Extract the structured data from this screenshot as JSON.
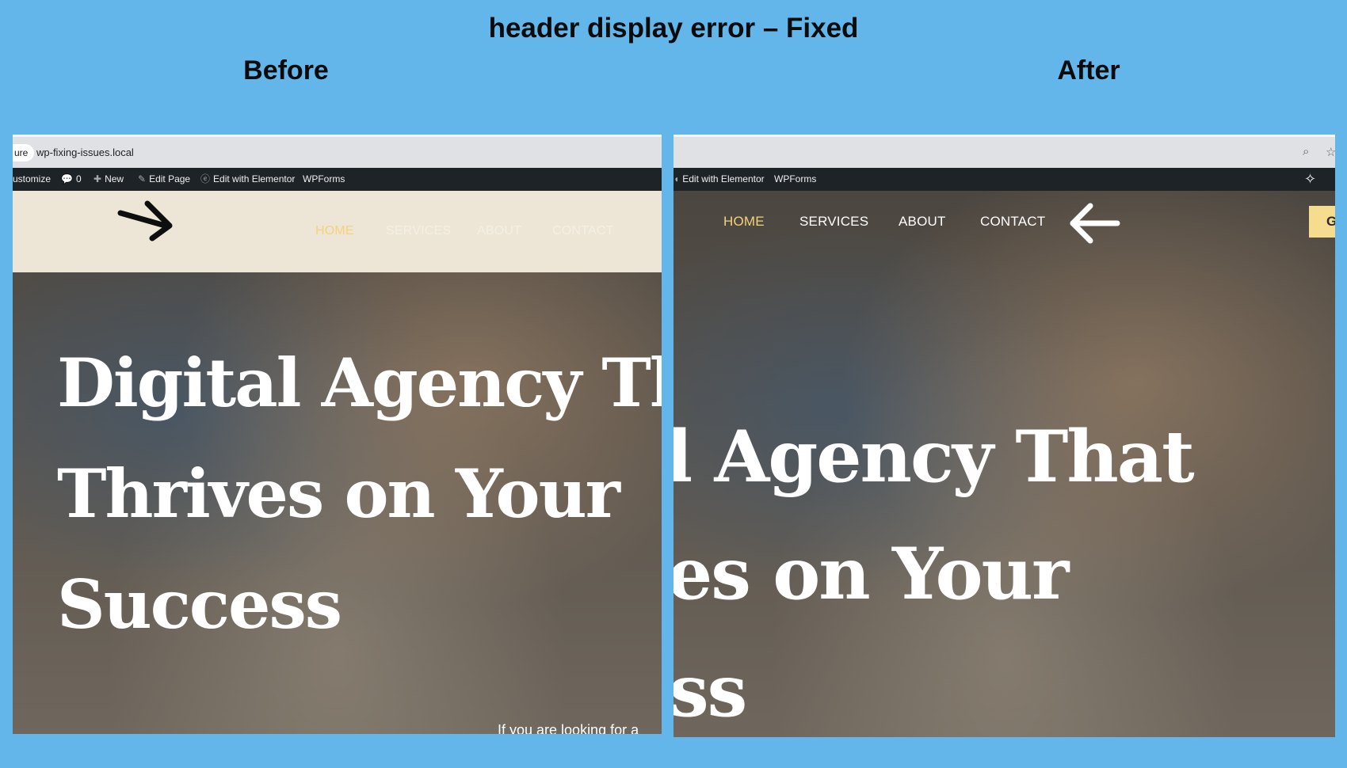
{
  "title": "header display error – Fixed",
  "labels": {
    "before": "Before",
    "after": "After"
  },
  "before": {
    "url_chip": "ure",
    "url": "wp-fixing-issues.local",
    "admin_bar": {
      "customize": "ustomize",
      "comments_count": "0",
      "new": "New",
      "edit_page": "Edit Page",
      "edit_elementor": "Edit with Elementor",
      "wpforms": "WPForms"
    },
    "nav": [
      "HOME",
      "SERVICES",
      "ABOUT",
      "CONTACT"
    ],
    "headline": [
      "Digital Agency Th",
      "Thrives on Your",
      "Success"
    ],
    "subtext": "If you are looking for a"
  },
  "after": {
    "admin_bar": {
      "edit_elementor": "Edit with Elementor",
      "wpforms": "WPForms"
    },
    "nav": [
      "HOME",
      "SERVICES",
      "ABOUT",
      "CONTACT"
    ],
    "cta": "G",
    "headline": [
      "l Agency That",
      "es on Your",
      "ss"
    ]
  },
  "colors": {
    "background": "#63b6e9",
    "admin_bar": "#1d2327",
    "nav_active": "#f3d27d",
    "header_strip_before": "#ede6d6",
    "cta": "#f6dc8f"
  }
}
